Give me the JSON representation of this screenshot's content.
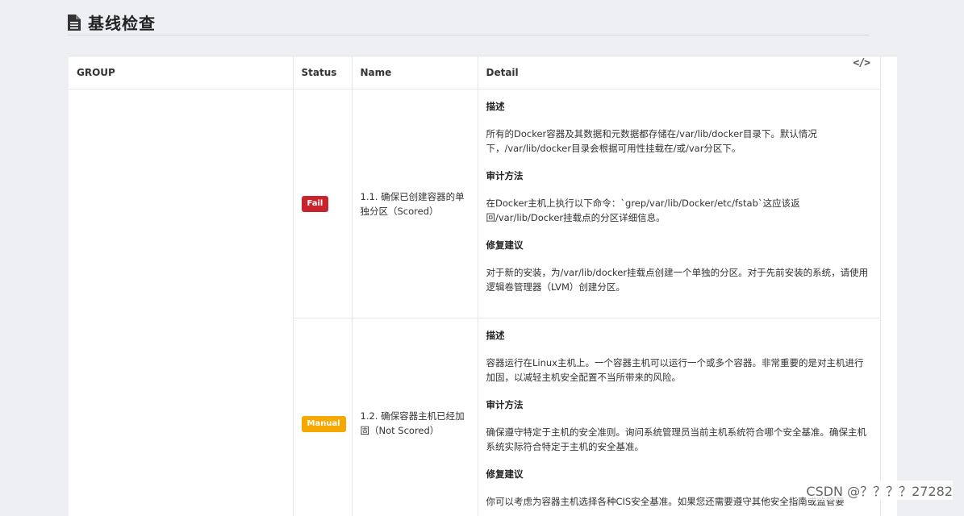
{
  "page": {
    "title": "基线检查"
  },
  "table": {
    "headers": {
      "group": "GROUP",
      "status": "Status",
      "name": "Name",
      "detail": "Detail"
    },
    "rows": [
      {
        "group": "",
        "status": "Fail",
        "name": "1.1. 确保已创建容器的单独分区（Scored）",
        "detail": {
          "desc_title": "描述",
          "desc": "所有的Docker容器及其数据和元数据都存储在/var/lib/docker目录下。默认情况下，/var/lib/docker目录会根据可用性挂载在/或/var分区下。",
          "audit_title": "审计方法",
          "audit": "在Docker主机上执行以下命令：`grep/var/lib/Docker/etc/fstab`这应该返回/var/lib/Docker挂载点的分区详细信息。",
          "fix_title": "修复建议",
          "fix": "对于新的安装，为/var/lib/docker挂载点创建一个单独的分区。对于先前安装的系统，请使用逻辑卷管理器（LVM）创建分区。"
        }
      },
      {
        "group": "",
        "status": "Manual",
        "name": "1.2. 确保容器主机已经加固（Not Scored）",
        "detail": {
          "desc_title": "描述",
          "desc": "容器运行在Linux主机上。一个容器主机可以运行一个或多个容器。非常重要的是对主机进行加固，以减轻主机安全配置不当所带来的风险。",
          "audit_title": "审计方法",
          "audit": "确保遵守特定于主机的安全准则。询问系统管理员当前主机系统符合哪个安全基准。确保主机系统实际符合特定于主机的安全基准。",
          "fix_title": "修复建议",
          "fix": "你可以考虑为容器主机选择各种CIS安全基准。如果您还需要遵守其他安全指南或监管要"
        }
      }
    ]
  },
  "watermark": "CSDN @？？？？27282",
  "colors": {
    "fail": "#c9242c",
    "manual": "#f5a800",
    "background": "#eeeff3"
  }
}
